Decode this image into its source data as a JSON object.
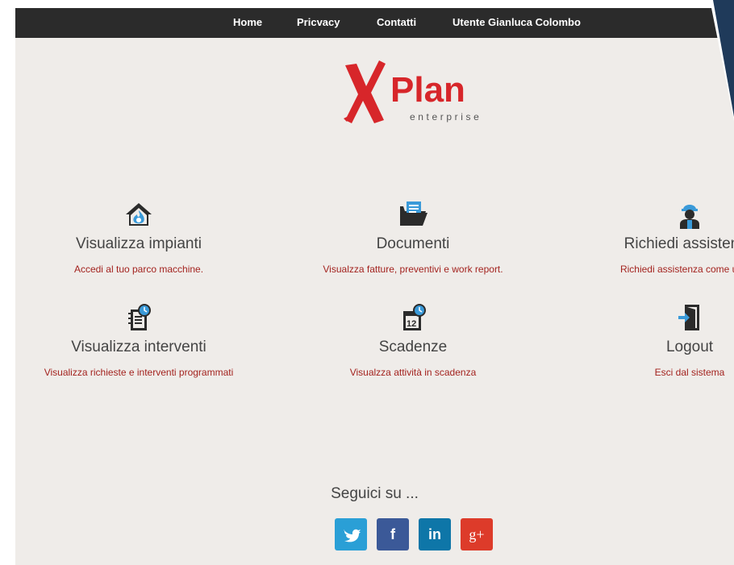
{
  "nav": {
    "items": [
      "Home",
      "Pricvacy",
      "Contatti",
      "Utente Gianluca Colombo"
    ]
  },
  "logo": {
    "brand": "Plan",
    "tagline": "enterprise"
  },
  "cards": [
    {
      "title": "Visualizza impianti",
      "desc": "Accedi al tuo parco macchine.",
      "icon": "house-fire-icon"
    },
    {
      "title": "Documenti",
      "desc": "Visualzza fatture, preventivi e work report.",
      "icon": "folder-document-icon"
    },
    {
      "title": "Richiedi assistenza",
      "desc": "Richiedi assistenza come utente",
      "icon": "technician-icon"
    },
    {
      "title": "Visualizza interventi",
      "desc": "Visualizza richieste e interventi programmati",
      "icon": "notepad-clock-icon"
    },
    {
      "title": "Scadenze",
      "desc": "Visualzza attività in scadenza",
      "icon": "calendar-clock-icon"
    },
    {
      "title": "Logout",
      "desc": "Esci dal sistema",
      "icon": "door-exit-icon"
    }
  ],
  "footer": {
    "follow": "Seguici su ...",
    "social": [
      {
        "name": "twitter",
        "glyph": "🐦",
        "color": "#2a9fd6"
      },
      {
        "name": "facebook",
        "glyph": "f",
        "color": "#3b5998"
      },
      {
        "name": "linkedin",
        "glyph": "in",
        "color": "#0e76a8"
      },
      {
        "name": "google-plus",
        "glyph": "g+",
        "color": "#dd3b2a"
      }
    ]
  },
  "colors": {
    "navbar": "#2b2b2b",
    "background": "#efece9",
    "accent_red": "#d7262a",
    "desc_text": "#a3231f",
    "icon_blue": "#3a9ad9",
    "corner_blue": "#1f3a5a"
  }
}
